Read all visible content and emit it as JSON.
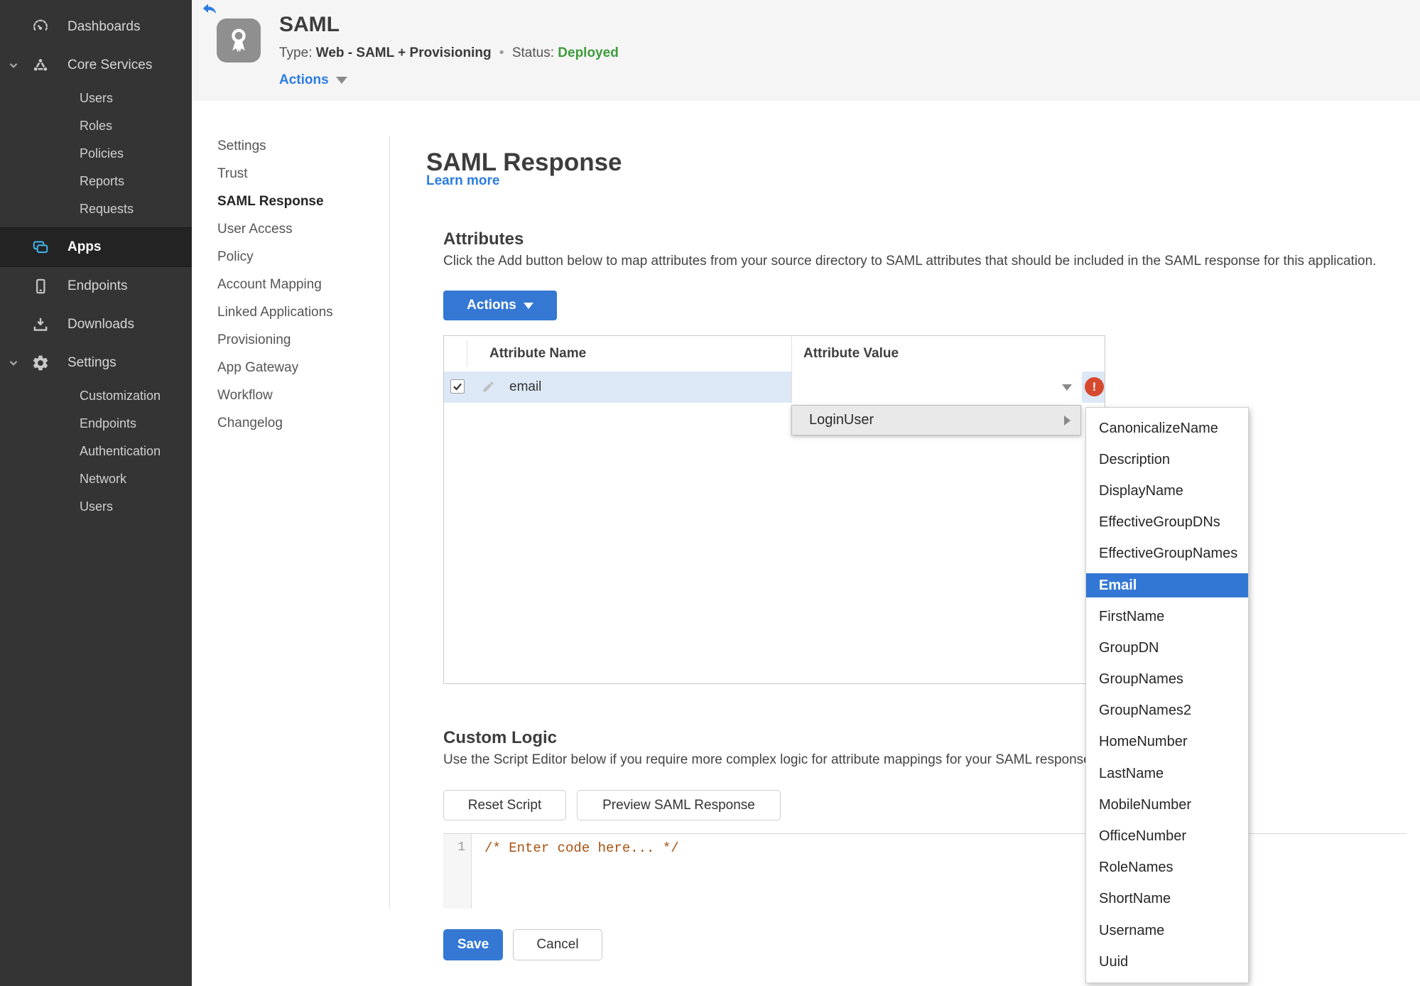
{
  "sidebar": {
    "items": [
      {
        "label": "Dashboards",
        "icon": "gauge-icon"
      },
      {
        "label": "Core Services",
        "icon": "cluster-icon",
        "expanded": true
      },
      {
        "label": "Apps",
        "icon": "apps-icon",
        "active": true
      },
      {
        "label": "Endpoints",
        "icon": "device-icon"
      },
      {
        "label": "Downloads",
        "icon": "download-icon"
      },
      {
        "label": "Settings",
        "icon": "gear-icon",
        "expanded": true
      }
    ],
    "core_services_children": [
      "Users",
      "Roles",
      "Policies",
      "Reports",
      "Requests"
    ],
    "settings_children": [
      "Customization",
      "Endpoints",
      "Authentication",
      "Network",
      "Users"
    ],
    "active_item": "Apps"
  },
  "header": {
    "title": "SAML",
    "type_label": "Type:",
    "type_value": "Web - SAML + Provisioning",
    "separator": "•",
    "status_label": "Status:",
    "status_value": "Deployed",
    "actions_label": "Actions"
  },
  "subnav": {
    "items": [
      "Settings",
      "Trust",
      "SAML Response",
      "User Access",
      "Policy",
      "Account Mapping",
      "Linked Applications",
      "Provisioning",
      "App Gateway",
      "Workflow",
      "Changelog"
    ],
    "active": "SAML Response"
  },
  "main": {
    "title": "SAML Response",
    "learn_more_label": "Learn more",
    "attributes_heading": "Attributes",
    "attributes_description": "Click the Add button below to map attributes from your source directory to SAML attributes that should be included in the SAML response for this application.",
    "actions_button_label": "Actions",
    "table": {
      "columns": [
        "Attribute Name",
        "Attribute Value"
      ],
      "row": {
        "attribute_name": "email",
        "attribute_value": "",
        "checked": true,
        "has_error": true
      }
    },
    "value_menu": {
      "label": "LoginUser",
      "submenu": [
        "CanonicalizeName",
        "Description",
        "DisplayName",
        "EffectiveGroupDNs",
        "EffectiveGroupNames",
        "Email",
        "FirstName",
        "GroupDN",
        "GroupNames",
        "GroupNames2",
        "HomeNumber",
        "LastName",
        "MobileNumber",
        "OfficeNumber",
        "RoleNames",
        "ShortName",
        "Username",
        "Uuid"
      ],
      "selected": "Email"
    },
    "custom_logic_heading": "Custom Logic",
    "custom_logic_description": "Use the Script Editor below if you require more complex logic for attribute mappings for your SAML response.",
    "reset_button_label": "Reset Script",
    "preview_button_label": "Preview SAML Response",
    "editor": {
      "line_number": "1",
      "code": "/* Enter code here... */"
    },
    "save_label": "Save",
    "cancel_label": "Cancel"
  },
  "colors": {
    "accent_blue": "#3578d3",
    "link_blue": "#2b7ce0",
    "status_green": "#3f9b3c",
    "error_red": "#d7492f",
    "sidebar_bg": "#343434",
    "sidebar_active_bg": "#232323",
    "apps_icon_blue": "#41b1e8",
    "row_highlight": "#dde8f6",
    "code_comment": "#a85212"
  }
}
